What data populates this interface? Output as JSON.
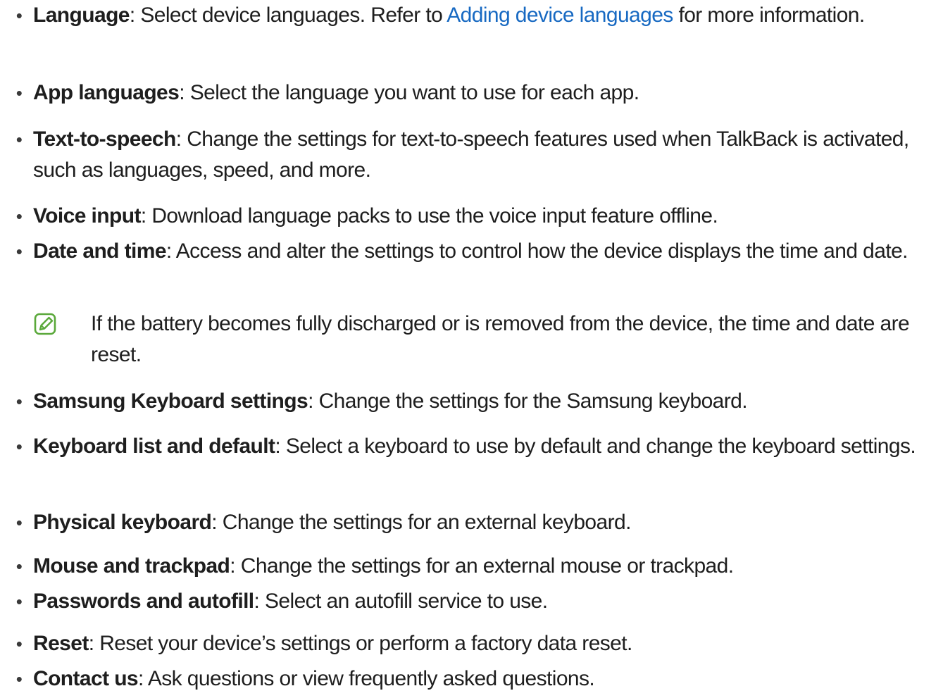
{
  "items": [
    {
      "term": "Language",
      "pre": ": Select device languages. Refer to ",
      "link": "Adding device languages",
      "post": " for more information."
    },
    {
      "term": "App languages",
      "desc": ": Select the language you want to use for each app."
    },
    {
      "term": "Text-to-speech",
      "desc": ": Change the settings for text-to-speech features used when TalkBack is activated, such as languages, speed, and more."
    },
    {
      "term": "Voice input",
      "desc": ": Download language packs to use the voice input feature offline."
    },
    {
      "term": "Date and time",
      "desc": ": Access and alter the settings to control how the device displays the time and date."
    },
    {
      "term": "Samsung Keyboard settings",
      "desc": ": Change the settings for the Samsung keyboard."
    },
    {
      "term": "Keyboard list and default",
      "desc": ": Select a keyboard to use by default and change the keyboard settings."
    },
    {
      "term": "Physical keyboard",
      "desc": ": Change the settings for an external keyboard."
    },
    {
      "term": "Mouse and trackpad",
      "desc": ": Change the settings for an external mouse or trackpad."
    },
    {
      "term": "Passwords and autofill",
      "desc": ": Select an autofill service to use."
    },
    {
      "term": "Reset",
      "desc": ": Reset your device’s settings or perform a factory data reset."
    },
    {
      "term": "Contact us",
      "desc": ": Ask questions or view frequently asked questions."
    }
  ],
  "note": {
    "icon": "note-pencil-icon",
    "text": "If the battery becomes fully discharged or is removed from the device, the time and date are reset."
  },
  "bullet": "•",
  "colors": {
    "link": "#1769c2",
    "icon": "#5aa83a",
    "text": "#1e1e1e"
  }
}
